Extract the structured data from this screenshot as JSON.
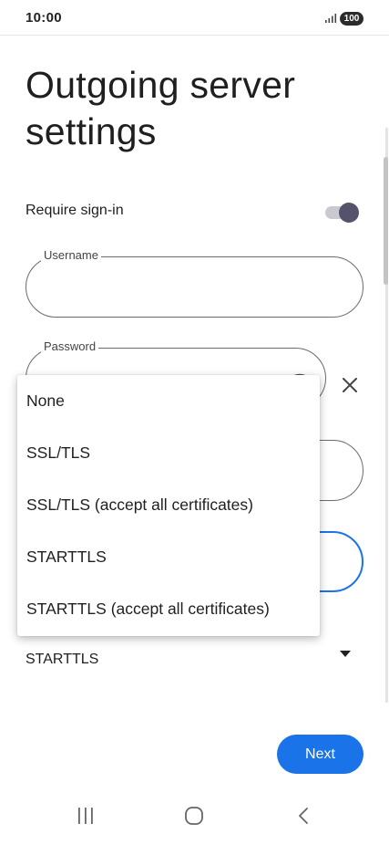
{
  "status_bar": {
    "time": "10:00",
    "battery": "100"
  },
  "page": {
    "title": "Outgoing server settings"
  },
  "require_signin": {
    "label": "Require sign-in",
    "enabled": true
  },
  "fields": {
    "username_label": "Username",
    "password_label": "Password"
  },
  "security": {
    "selected": "STARTTLS",
    "options": [
      "None",
      "SSL/TLS",
      "SSL/TLS (accept all certificates)",
      "STARTTLS",
      "STARTTLS (accept all certificates)"
    ]
  },
  "actions": {
    "next_label": "Next"
  },
  "colors": {
    "accent": "#1a73e8",
    "toggle_thumb": "#55536b"
  },
  "icons": {
    "signal": "signal-icon",
    "eye": "eye-icon",
    "clear": "close-icon",
    "dropdown": "dropdown-arrow-icon",
    "recents": "recents-icon",
    "home": "home-icon",
    "back": "back-icon"
  }
}
